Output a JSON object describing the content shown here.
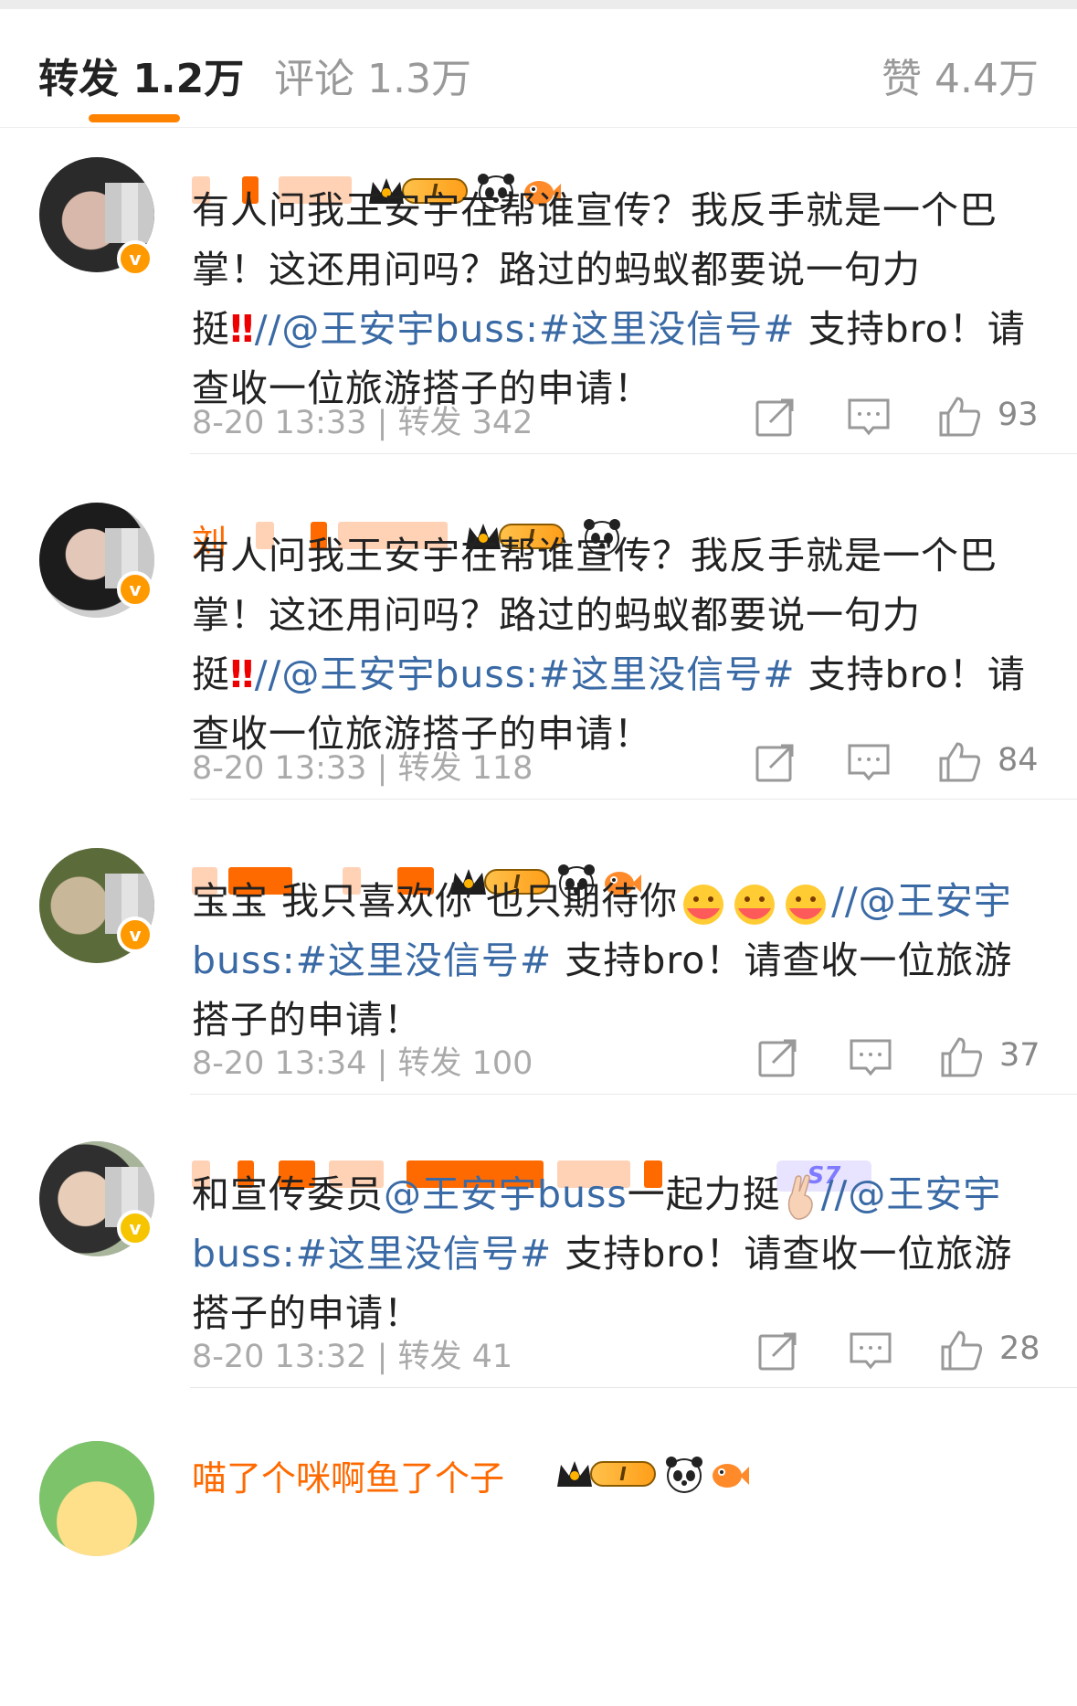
{
  "tabs": {
    "repost_label": "转发 1.2万",
    "comment_label": "评论 1.3万",
    "like_label": "赞 4.4万"
  },
  "accent_color": "#ff8200",
  "link_color": "#3a6aa5",
  "posts": [
    {
      "text_pre": "有人问我王安宇在帮谁宣传？我反手就是一个巴掌！这还用问吗？路过的蚂蚁都要说一句力挺",
      "text_bang": "‼",
      "text_slash": "//",
      "mention": "@王安宇buss",
      "colon": ":",
      "hashtag": "#这里没信号#",
      "text_post": " 支持bro！请查收一位旅游搭子的申请！",
      "time": "8-20 13:33",
      "repost": "转发 342",
      "likes": "93",
      "level": "I"
    },
    {
      "text_pre": "有人问我王安宇在帮谁宣传？我反手就是一个巴掌！这还用问吗？路过的蚂蚁都要说一句力挺",
      "text_bang": "‼",
      "text_slash": "//",
      "mention": "@王安宇buss",
      "colon": ":",
      "hashtag": "#这里没信号#",
      "text_post": " 支持bro！请查收一位旅游搭子的申请！",
      "time": "8-20 13:33",
      "repost": "转发 118",
      "likes": "84",
      "name_partial": "刘",
      "level": "I"
    },
    {
      "text_pre": "宝宝 我只喜欢你 也只期待你",
      "text_slash": "//",
      "mention": "@王安宇buss",
      "colon": ":",
      "hashtag": "#这里没信号#",
      "text_post": " 支持bro！请查收一位旅游搭子的申请！",
      "time": "8-20 13:34",
      "repost": "转发 100",
      "likes": "37",
      "level": "I"
    },
    {
      "text_pre": "和宣传委员",
      "mention_inline": "@王安宇buss",
      "text_mid": "一起力挺",
      "text_slash": "//",
      "mention": "@王安宇buss",
      "colon": ":",
      "hashtag": "#这里没信号#",
      "text_post": " 支持bro！请查收一位旅游搭子的申请！",
      "time": "8-20 13:32",
      "repost": "转发 41",
      "likes": "28",
      "badge": "S7"
    },
    {
      "name": "喵了个咪啊鱼了个子",
      "level": "I"
    }
  ]
}
